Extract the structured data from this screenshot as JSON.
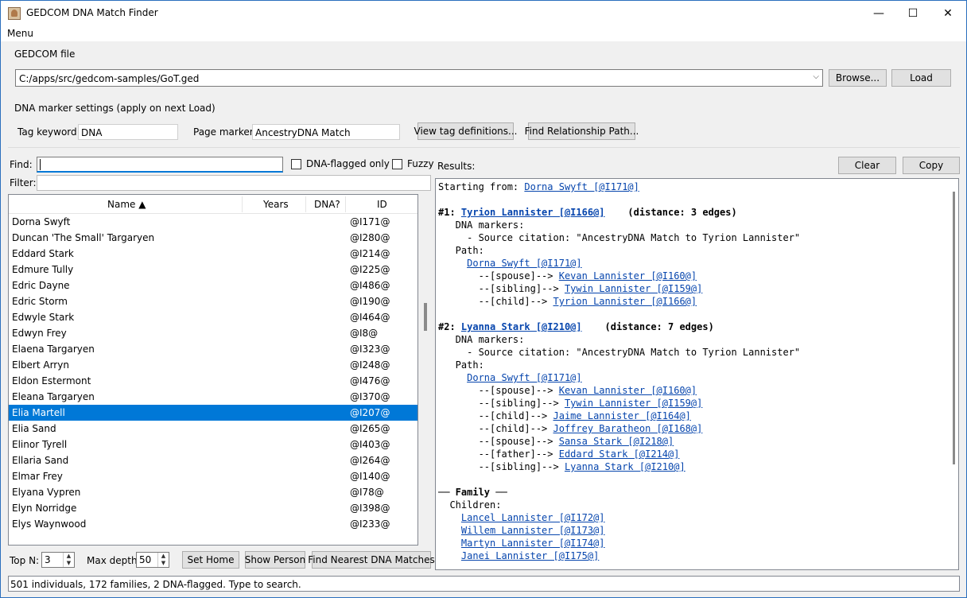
{
  "window": {
    "title": "GEDCOM DNA Match Finder",
    "minimize_glyph": "—",
    "maximize_glyph": "☐",
    "close_glyph": "✕"
  },
  "menu": {
    "label": "Menu"
  },
  "gedcom": {
    "section_label": "GEDCOM file",
    "path": "C:/apps/src/gedcom-samples/GoT.ged",
    "browse_label": "Browse...",
    "load_label": "Load"
  },
  "dna_settings": {
    "section_label": "DNA marker settings (apply on next Load)",
    "tag_keyword_label": "Tag keyword:",
    "tag_keyword_value": "DNA",
    "page_marker_label": "Page marker:",
    "page_marker_value": "AncestryDNA Match",
    "view_tags_label": "View tag definitions...",
    "find_path_label": "Find Relationship Path..."
  },
  "search": {
    "find_label": "Find:",
    "find_value": "",
    "dna_only_label": "DNA-flagged only",
    "dna_only_checked": false,
    "fuzzy_label": "Fuzzy",
    "fuzzy_checked": false,
    "filter_label": "Filter:",
    "filter_value": ""
  },
  "list": {
    "columns": {
      "name": "Name ▲",
      "years": "Years",
      "dna": "DNA?",
      "id": "ID"
    },
    "selected_index": 12,
    "rows": [
      {
        "name": "Dorna Swyft",
        "id": "@I171@"
      },
      {
        "name": "Duncan 'The Small' Targaryen",
        "id": "@I280@"
      },
      {
        "name": "Eddard Stark",
        "id": "@I214@"
      },
      {
        "name": "Edmure Tully",
        "id": "@I225@"
      },
      {
        "name": "Edric Dayne",
        "id": "@I486@"
      },
      {
        "name": "Edric Storm",
        "id": "@I190@"
      },
      {
        "name": "Edwyle Stark",
        "id": "@I464@"
      },
      {
        "name": "Edwyn Frey",
        "id": "@I8@"
      },
      {
        "name": "Elaena Targaryen",
        "id": "@I323@"
      },
      {
        "name": "Elbert Arryn",
        "id": "@I248@"
      },
      {
        "name": "Eldon Estermont",
        "id": "@I476@"
      },
      {
        "name": "Eleana Targaryen",
        "id": "@I370@"
      },
      {
        "name": "Elia Martell",
        "id": "@I207@"
      },
      {
        "name": "Elia Sand",
        "id": "@I265@"
      },
      {
        "name": "Elinor Tyrell",
        "id": "@I403@"
      },
      {
        "name": "Ellaria Sand",
        "id": "@I264@"
      },
      {
        "name": "Elmar Frey",
        "id": "@I140@"
      },
      {
        "name": "Elyana Vypren",
        "id": "@I78@"
      },
      {
        "name": "Elyn Norridge",
        "id": "@I398@"
      },
      {
        "name": "Elys Waynwood",
        "id": "@I233@"
      }
    ]
  },
  "bottom_controls": {
    "top_n_label": "Top N:",
    "top_n_value": "3",
    "max_depth_label": "Max depth:",
    "max_depth_value": "50",
    "set_home_label": "Set Home",
    "show_person_label": "Show Person",
    "find_nearest_label": "Find Nearest DNA Matches"
  },
  "results": {
    "label": "Results:",
    "clear_label": "Clear",
    "copy_label": "Copy",
    "lines": [
      {
        "parts": [
          {
            "t": "Starting from: "
          },
          {
            "t": "Dorna Swyft [@I171@]",
            "link": true
          }
        ]
      },
      {
        "parts": []
      },
      {
        "parts": [
          {
            "t": "#1: ",
            "bold": true
          },
          {
            "t": "Tyrion Lannister [@I166@]",
            "link": true,
            "bold": true
          },
          {
            "t": "    (distance: 3 edges)",
            "bold": true
          }
        ]
      },
      {
        "parts": [
          {
            "t": "   DNA markers:"
          }
        ]
      },
      {
        "parts": [
          {
            "t": "     - Source citation: \"AncestryDNA Match to Tyrion Lannister\""
          }
        ]
      },
      {
        "parts": [
          {
            "t": "   Path:"
          }
        ]
      },
      {
        "parts": [
          {
            "t": "     "
          },
          {
            "t": "Dorna Swyft [@I171@]",
            "link": true
          }
        ]
      },
      {
        "parts": [
          {
            "t": "       --[spouse]--> "
          },
          {
            "t": "Kevan Lannister [@I160@]",
            "link": true
          }
        ]
      },
      {
        "parts": [
          {
            "t": "       --[sibling]--> "
          },
          {
            "t": "Tywin Lannister [@I159@]",
            "link": true
          }
        ]
      },
      {
        "parts": [
          {
            "t": "       --[child]--> "
          },
          {
            "t": "Tyrion Lannister [@I166@]",
            "link": true
          }
        ]
      },
      {
        "parts": []
      },
      {
        "parts": [
          {
            "t": "#2: ",
            "bold": true
          },
          {
            "t": "Lyanna Stark [@I210@]",
            "link": true,
            "bold": true
          },
          {
            "t": "    (distance: 7 edges)",
            "bold": true
          }
        ]
      },
      {
        "parts": [
          {
            "t": "   DNA markers:"
          }
        ]
      },
      {
        "parts": [
          {
            "t": "     - Source citation: \"AncestryDNA Match to Tyrion Lannister\""
          }
        ]
      },
      {
        "parts": [
          {
            "t": "   Path:"
          }
        ]
      },
      {
        "parts": [
          {
            "t": "     "
          },
          {
            "t": "Dorna Swyft [@I171@]",
            "link": true
          }
        ]
      },
      {
        "parts": [
          {
            "t": "       --[spouse]--> "
          },
          {
            "t": "Kevan Lannister [@I160@]",
            "link": true
          }
        ]
      },
      {
        "parts": [
          {
            "t": "       --[sibling]--> "
          },
          {
            "t": "Tywin Lannister [@I159@]",
            "link": true
          }
        ]
      },
      {
        "parts": [
          {
            "t": "       --[child]--> "
          },
          {
            "t": "Jaime Lannister [@I164@]",
            "link": true
          }
        ]
      },
      {
        "parts": [
          {
            "t": "       --[child]--> "
          },
          {
            "t": "Joffrey Baratheon [@I168@]",
            "link": true
          }
        ]
      },
      {
        "parts": [
          {
            "t": "       --[spouse]--> "
          },
          {
            "t": "Sansa Stark [@I218@]",
            "link": true
          }
        ]
      },
      {
        "parts": [
          {
            "t": "       --[father]--> "
          },
          {
            "t": "Eddard Stark [@I214@]",
            "link": true
          }
        ]
      },
      {
        "parts": [
          {
            "t": "       --[sibling]--> "
          },
          {
            "t": "Lyanna Stark [@I210@]",
            "link": true
          }
        ]
      },
      {
        "parts": []
      },
      {
        "parts": [
          {
            "t": "── Family ──",
            "bold": true
          }
        ]
      },
      {
        "parts": [
          {
            "t": "  Children:"
          }
        ]
      },
      {
        "parts": [
          {
            "t": "    "
          },
          {
            "t": "Lancel Lannister [@I172@]",
            "link": true
          }
        ]
      },
      {
        "parts": [
          {
            "t": "    "
          },
          {
            "t": "Willem Lannister [@I173@]",
            "link": true
          }
        ]
      },
      {
        "parts": [
          {
            "t": "    "
          },
          {
            "t": "Martyn Lannister [@I174@]",
            "link": true
          }
        ]
      },
      {
        "parts": [
          {
            "t": "    "
          },
          {
            "t": "Janei Lannister [@I175@]",
            "link": true
          }
        ]
      }
    ]
  },
  "status": {
    "text": "501 individuals, 172 families, 2 DNA-flagged.  Type to search."
  }
}
